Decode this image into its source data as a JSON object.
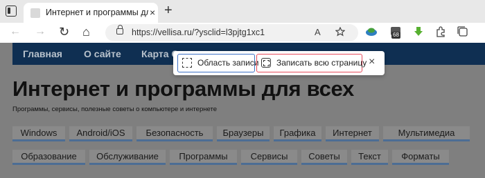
{
  "browser": {
    "tab": {
      "title": "Интернет и программы для все",
      "close_icon": "×"
    },
    "new_tab_icon": "+",
    "nav": {
      "back_icon": "←",
      "forward_icon": "→",
      "refresh_icon": "↻",
      "home_icon": "⌂"
    },
    "address": {
      "url": "https://vellisa.ru/?ysclid=l3pjtg1xc1"
    },
    "read_aloud_icon": "A",
    "extensions_badge": "68"
  },
  "site": {
    "nav": [
      "Главная",
      "О сайте",
      "Карта С"
    ],
    "title": "Интернет и программы для всех",
    "subtitle": "Программы, сервисы, полезные советы о компьютере и интернете",
    "categories_row1": [
      "Windows",
      "Android/iOS",
      "Безопасность",
      "Браузеры",
      "Графика",
      "Интернет",
      "Мультимедиа"
    ],
    "categories_row2": [
      "Образование",
      "Обслуживание",
      "Программы",
      "Сервисы",
      "Советы",
      "Текст",
      "Форматы"
    ]
  },
  "capture_popup": {
    "area_label": "Область записи",
    "full_label": "Записать всю страницу",
    "close_icon": "×"
  }
}
